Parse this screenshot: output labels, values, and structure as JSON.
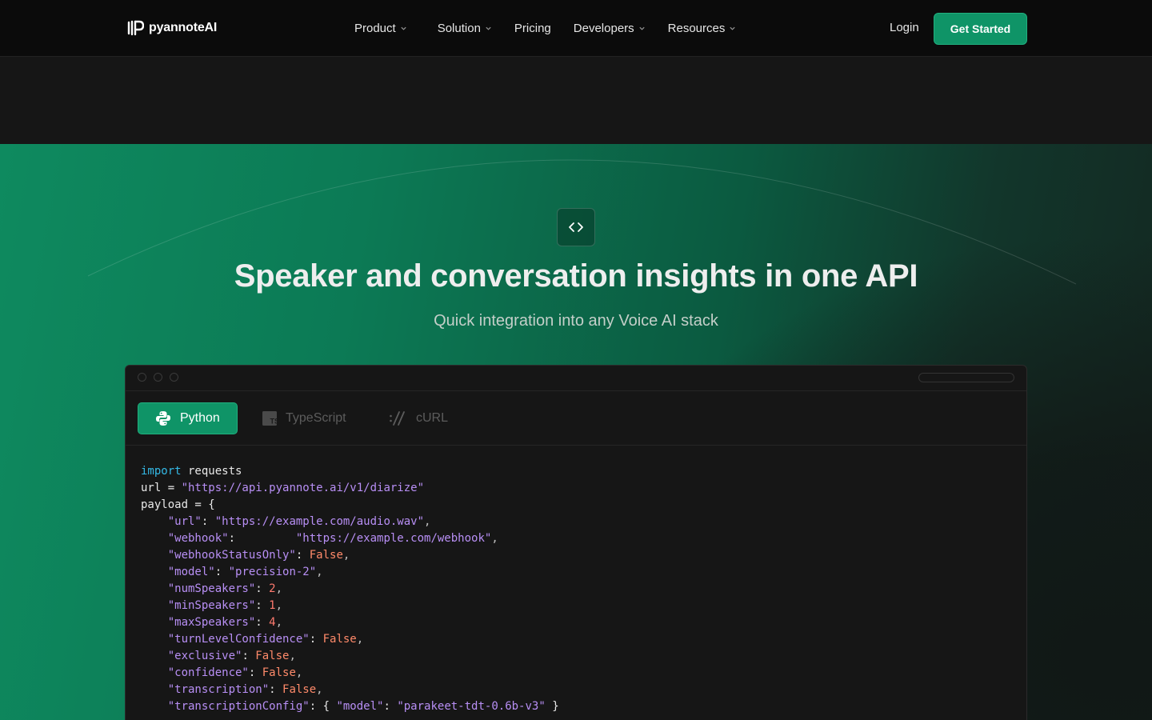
{
  "nav": {
    "brand": "pyannoteAI",
    "links": [
      {
        "label": "Product",
        "dropdown": true
      },
      {
        "label": "Solution",
        "dropdown": true
      },
      {
        "label": "Pricing",
        "dropdown": false
      },
      {
        "label": "Developers",
        "dropdown": true
      },
      {
        "label": "Resources",
        "dropdown": true
      }
    ],
    "login": "Login",
    "cta": "Get Started"
  },
  "hero": {
    "title": "Speaker and conversation insights in one API",
    "subtitle": "Quick integration into any Voice AI stack"
  },
  "code_window": {
    "tabs": [
      {
        "label": "Python",
        "icon": "python-icon",
        "active": true
      },
      {
        "label": "TypeScript",
        "icon": "typescript-icon",
        "active": false
      },
      {
        "label": "cURL",
        "icon": "curl-icon",
        "active": false
      }
    ],
    "lines": [
      [
        {
          "t": "import",
          "c": "kw"
        },
        {
          "t": " requests",
          "c": ""
        }
      ],
      [
        {
          "t": "url = ",
          "c": ""
        },
        {
          "t": "\"https://api.pyannote.ai/v1/diarize\"",
          "c": "str"
        }
      ],
      [
        {
          "t": "payload = {",
          "c": ""
        }
      ],
      [
        {
          "t": "    ",
          "c": ""
        },
        {
          "t": "\"url\"",
          "c": "str"
        },
        {
          "t": ": ",
          "c": ""
        },
        {
          "t": "\"https://example.com/audio.wav\"",
          "c": "str"
        },
        {
          "t": ",",
          "c": "pun"
        }
      ],
      [
        {
          "t": "    ",
          "c": ""
        },
        {
          "t": "\"webhook\"",
          "c": "str"
        },
        {
          "t": ":         ",
          "c": ""
        },
        {
          "t": "\"https://example.com/webhook\"",
          "c": "str"
        },
        {
          "t": ",",
          "c": "pun"
        }
      ],
      [
        {
          "t": "    ",
          "c": ""
        },
        {
          "t": "\"webhookStatusOnly\"",
          "c": "str"
        },
        {
          "t": ": ",
          "c": ""
        },
        {
          "t": "False",
          "c": "bool"
        },
        {
          "t": ",",
          "c": "pun"
        }
      ],
      [
        {
          "t": "    ",
          "c": ""
        },
        {
          "t": "\"model\"",
          "c": "str"
        },
        {
          "t": ": ",
          "c": ""
        },
        {
          "t": "\"precision-2\"",
          "c": "str"
        },
        {
          "t": ",",
          "c": "pun"
        }
      ],
      [
        {
          "t": "    ",
          "c": ""
        },
        {
          "t": "\"numSpeakers\"",
          "c": "str"
        },
        {
          "t": ": ",
          "c": ""
        },
        {
          "t": "2",
          "c": "num"
        },
        {
          "t": ",",
          "c": "pun"
        }
      ],
      [
        {
          "t": "    ",
          "c": ""
        },
        {
          "t": "\"minSpeakers\"",
          "c": "str"
        },
        {
          "t": ": ",
          "c": ""
        },
        {
          "t": "1",
          "c": "num"
        },
        {
          "t": ",",
          "c": "pun"
        }
      ],
      [
        {
          "t": "    ",
          "c": ""
        },
        {
          "t": "\"maxSpeakers\"",
          "c": "str"
        },
        {
          "t": ": ",
          "c": ""
        },
        {
          "t": "4",
          "c": "num"
        },
        {
          "t": ",",
          "c": "pun"
        }
      ],
      [
        {
          "t": "    ",
          "c": ""
        },
        {
          "t": "\"turnLevelConfidence\"",
          "c": "str"
        },
        {
          "t": ": ",
          "c": ""
        },
        {
          "t": "False",
          "c": "bool"
        },
        {
          "t": ",",
          "c": "pun"
        }
      ],
      [
        {
          "t": "    ",
          "c": ""
        },
        {
          "t": "\"exclusive\"",
          "c": "str"
        },
        {
          "t": ": ",
          "c": ""
        },
        {
          "t": "False",
          "c": "bool"
        },
        {
          "t": ",",
          "c": "pun"
        }
      ],
      [
        {
          "t": "    ",
          "c": ""
        },
        {
          "t": "\"confidence\"",
          "c": "str"
        },
        {
          "t": ": ",
          "c": ""
        },
        {
          "t": "False",
          "c": "bool"
        },
        {
          "t": ",",
          "c": "pun"
        }
      ],
      [
        {
          "t": "    ",
          "c": ""
        },
        {
          "t": "\"transcription\"",
          "c": "str"
        },
        {
          "t": ": ",
          "c": ""
        },
        {
          "t": "False",
          "c": "bool"
        },
        {
          "t": ",",
          "c": "pun"
        }
      ],
      [
        {
          "t": "    ",
          "c": ""
        },
        {
          "t": "\"transcriptionConfig\"",
          "c": "str"
        },
        {
          "t": ": { ",
          "c": ""
        },
        {
          "t": "\"model\"",
          "c": "str"
        },
        {
          "t": ": ",
          "c": ""
        },
        {
          "t": "\"parakeet-tdt-0.6b-v3\"",
          "c": "str"
        },
        {
          "t": " }",
          "c": ""
        }
      ]
    ]
  },
  "colors": {
    "accent": "#0f9467",
    "keyword": "#34b9e6",
    "string": "#b88ff5",
    "number": "#ff7a6e"
  }
}
